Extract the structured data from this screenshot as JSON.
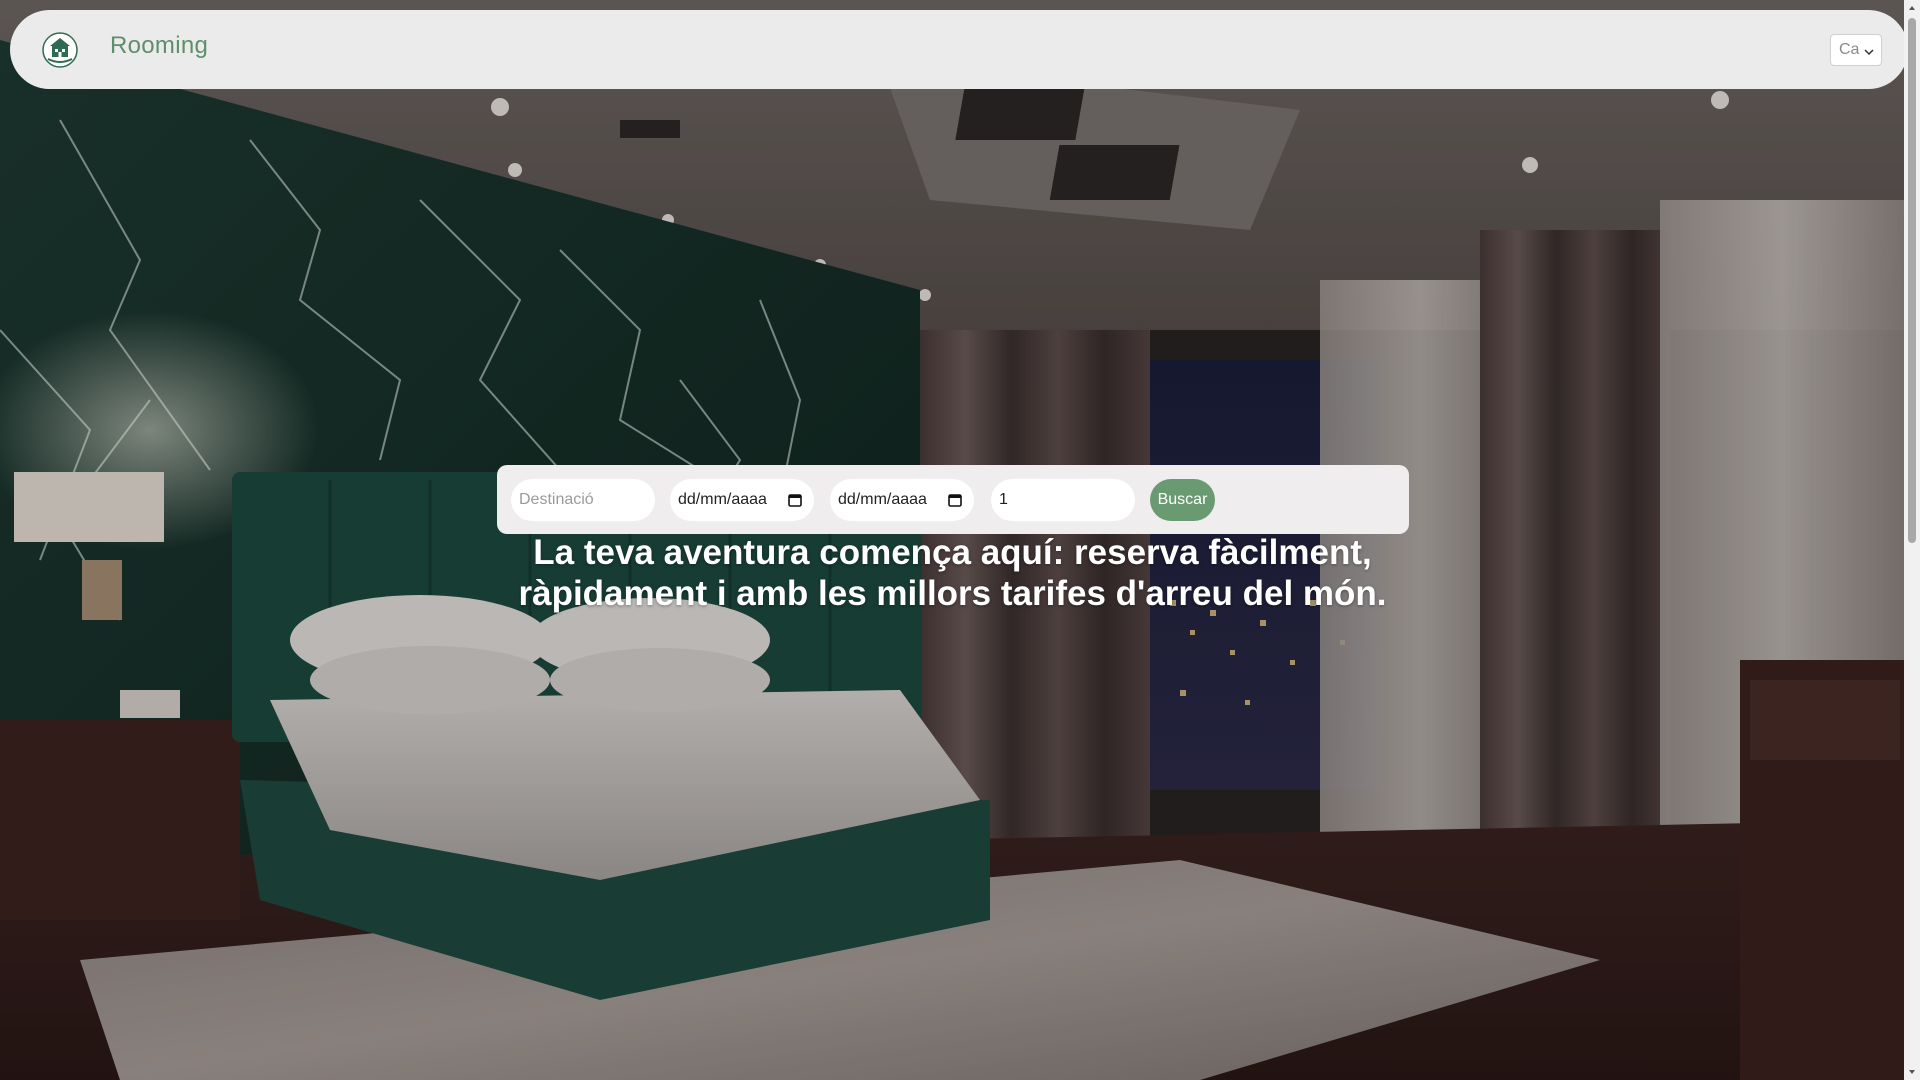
{
  "navbar": {
    "brand": "Rooming",
    "logo_icon": "hotel-logo-icon",
    "language": {
      "selected": "Ca",
      "icon": "chevron-down-icon"
    }
  },
  "search": {
    "destination_placeholder": "Destinació",
    "checkin_value": "dd/mm/aaaa",
    "checkout_value": "dd/mm/aaaa",
    "guests_value": "1",
    "calendar_icon": "calendar-icon",
    "button_label": "Buscar"
  },
  "hero": {
    "headline_line1": "La teva aventura comença aquí: reserva fàcilment,",
    "headline_line2": "ràpidament i amb les millors tarifes d'arreu del món."
  },
  "colors": {
    "brand_green": "#5f8f6a",
    "button_green": "#6a9a72",
    "navbar_bg": "#ecebeb",
    "search_panel_bg": "#efeded"
  }
}
